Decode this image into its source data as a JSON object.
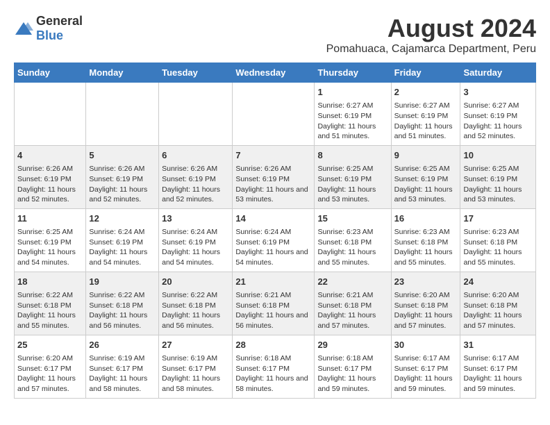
{
  "header": {
    "logo": {
      "general": "General",
      "blue": "Blue"
    },
    "main_title": "August 2024",
    "subtitle": "Pomahuaca, Cajamarca Department, Peru"
  },
  "weekdays": [
    "Sunday",
    "Monday",
    "Tuesday",
    "Wednesday",
    "Thursday",
    "Friday",
    "Saturday"
  ],
  "weeks": [
    [
      {
        "day": "",
        "info": ""
      },
      {
        "day": "",
        "info": ""
      },
      {
        "day": "",
        "info": ""
      },
      {
        "day": "",
        "info": ""
      },
      {
        "day": "1",
        "info": "Sunrise: 6:27 AM\nSunset: 6:19 PM\nDaylight: 11 hours and 51 minutes."
      },
      {
        "day": "2",
        "info": "Sunrise: 6:27 AM\nSunset: 6:19 PM\nDaylight: 11 hours and 51 minutes."
      },
      {
        "day": "3",
        "info": "Sunrise: 6:27 AM\nSunset: 6:19 PM\nDaylight: 11 hours and 52 minutes."
      }
    ],
    [
      {
        "day": "4",
        "info": "Sunrise: 6:26 AM\nSunset: 6:19 PM\nDaylight: 11 hours and 52 minutes."
      },
      {
        "day": "5",
        "info": "Sunrise: 6:26 AM\nSunset: 6:19 PM\nDaylight: 11 hours and 52 minutes."
      },
      {
        "day": "6",
        "info": "Sunrise: 6:26 AM\nSunset: 6:19 PM\nDaylight: 11 hours and 52 minutes."
      },
      {
        "day": "7",
        "info": "Sunrise: 6:26 AM\nSunset: 6:19 PM\nDaylight: 11 hours and 53 minutes."
      },
      {
        "day": "8",
        "info": "Sunrise: 6:25 AM\nSunset: 6:19 PM\nDaylight: 11 hours and 53 minutes."
      },
      {
        "day": "9",
        "info": "Sunrise: 6:25 AM\nSunset: 6:19 PM\nDaylight: 11 hours and 53 minutes."
      },
      {
        "day": "10",
        "info": "Sunrise: 6:25 AM\nSunset: 6:19 PM\nDaylight: 11 hours and 53 minutes."
      }
    ],
    [
      {
        "day": "11",
        "info": "Sunrise: 6:25 AM\nSunset: 6:19 PM\nDaylight: 11 hours and 54 minutes."
      },
      {
        "day": "12",
        "info": "Sunrise: 6:24 AM\nSunset: 6:19 PM\nDaylight: 11 hours and 54 minutes."
      },
      {
        "day": "13",
        "info": "Sunrise: 6:24 AM\nSunset: 6:19 PM\nDaylight: 11 hours and 54 minutes."
      },
      {
        "day": "14",
        "info": "Sunrise: 6:24 AM\nSunset: 6:19 PM\nDaylight: 11 hours and 54 minutes."
      },
      {
        "day": "15",
        "info": "Sunrise: 6:23 AM\nSunset: 6:18 PM\nDaylight: 11 hours and 55 minutes."
      },
      {
        "day": "16",
        "info": "Sunrise: 6:23 AM\nSunset: 6:18 PM\nDaylight: 11 hours and 55 minutes."
      },
      {
        "day": "17",
        "info": "Sunrise: 6:23 AM\nSunset: 6:18 PM\nDaylight: 11 hours and 55 minutes."
      }
    ],
    [
      {
        "day": "18",
        "info": "Sunrise: 6:22 AM\nSunset: 6:18 PM\nDaylight: 11 hours and 55 minutes."
      },
      {
        "day": "19",
        "info": "Sunrise: 6:22 AM\nSunset: 6:18 PM\nDaylight: 11 hours and 56 minutes."
      },
      {
        "day": "20",
        "info": "Sunrise: 6:22 AM\nSunset: 6:18 PM\nDaylight: 11 hours and 56 minutes."
      },
      {
        "day": "21",
        "info": "Sunrise: 6:21 AM\nSunset: 6:18 PM\nDaylight: 11 hours and 56 minutes."
      },
      {
        "day": "22",
        "info": "Sunrise: 6:21 AM\nSunset: 6:18 PM\nDaylight: 11 hours and 57 minutes."
      },
      {
        "day": "23",
        "info": "Sunrise: 6:20 AM\nSunset: 6:18 PM\nDaylight: 11 hours and 57 minutes."
      },
      {
        "day": "24",
        "info": "Sunrise: 6:20 AM\nSunset: 6:18 PM\nDaylight: 11 hours and 57 minutes."
      }
    ],
    [
      {
        "day": "25",
        "info": "Sunrise: 6:20 AM\nSunset: 6:17 PM\nDaylight: 11 hours and 57 minutes."
      },
      {
        "day": "26",
        "info": "Sunrise: 6:19 AM\nSunset: 6:17 PM\nDaylight: 11 hours and 58 minutes."
      },
      {
        "day": "27",
        "info": "Sunrise: 6:19 AM\nSunset: 6:17 PM\nDaylight: 11 hours and 58 minutes."
      },
      {
        "day": "28",
        "info": "Sunrise: 6:18 AM\nSunset: 6:17 PM\nDaylight: 11 hours and 58 minutes."
      },
      {
        "day": "29",
        "info": "Sunrise: 6:18 AM\nSunset: 6:17 PM\nDaylight: 11 hours and 59 minutes."
      },
      {
        "day": "30",
        "info": "Sunrise: 6:17 AM\nSunset: 6:17 PM\nDaylight: 11 hours and 59 minutes."
      },
      {
        "day": "31",
        "info": "Sunrise: 6:17 AM\nSunset: 6:17 PM\nDaylight: 11 hours and 59 minutes."
      }
    ]
  ]
}
